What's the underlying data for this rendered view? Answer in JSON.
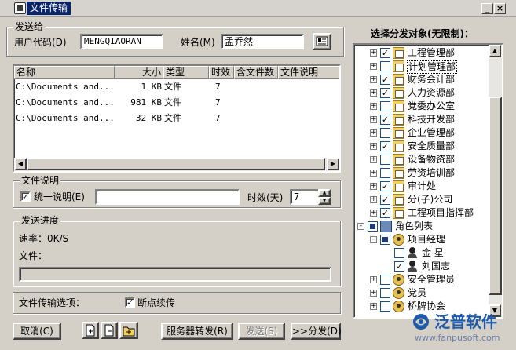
{
  "window": {
    "title": "文件传输",
    "minimize": "_",
    "close": "×"
  },
  "sender": {
    "group_label": "发送给",
    "user_code_label": "用户代码(D)",
    "user_code_value": "MENGQIAORAN",
    "name_label": "姓名(M)",
    "name_value": "孟乔然"
  },
  "file_list": {
    "columns": [
      "名称",
      "大小",
      "类型",
      "时效",
      "含文件数",
      "文件说明"
    ],
    "rows": [
      {
        "name": "C:\\Documents and...",
        "size": "1 KB",
        "type": "文件",
        "expiry": "7"
      },
      {
        "name": "C:\\Documents and...",
        "size": "981 KB",
        "type": "文件",
        "expiry": "7"
      },
      {
        "name": "C:\\Documents and...",
        "size": "32 KB",
        "type": "文件",
        "expiry": "7"
      }
    ]
  },
  "file_desc": {
    "group_label": "文件说明",
    "unified_label": "统一说明(E)",
    "unified_checked": true,
    "expiry_label": "时效(天)",
    "expiry_value": "7"
  },
  "progress": {
    "group_label": "发送进度",
    "rate_label": "速率：0K/S",
    "file_label": "文件：",
    "value": 0
  },
  "options": {
    "label": "文件传输选项：",
    "resume_label": "断点续传",
    "resume_checked": true
  },
  "buttons": {
    "cancel": "取消(C)",
    "server_forward": "服务器转发(R)",
    "send": "发送(S)",
    "distribute": ">>分发(D)"
  },
  "tree": {
    "title": "选择分发对象(无限制)：",
    "items": [
      {
        "label": "工程管理部",
        "checked": true,
        "level": 1,
        "icon": "dept-icon",
        "expander": "+"
      },
      {
        "label": "计划管理部",
        "checked": false,
        "level": 1,
        "icon": "dept-icon",
        "expander": "+",
        "selected": true
      },
      {
        "label": "财务会计部",
        "checked": true,
        "level": 1,
        "icon": "dept-icon",
        "expander": "+"
      },
      {
        "label": "人力资源部",
        "checked": true,
        "level": 1,
        "icon": "dept-icon",
        "expander": "+"
      },
      {
        "label": "党委办公室",
        "checked": false,
        "level": 1,
        "icon": "dept-icon",
        "expander": "+"
      },
      {
        "label": "科技开发部",
        "checked": true,
        "level": 1,
        "icon": "dept-icon",
        "expander": "+"
      },
      {
        "label": "企业管理部",
        "checked": false,
        "level": 1,
        "icon": "dept-icon",
        "expander": "+"
      },
      {
        "label": "安全质量部",
        "checked": true,
        "level": 1,
        "icon": "dept-icon",
        "expander": "+"
      },
      {
        "label": "设备物资部",
        "checked": false,
        "level": 1,
        "icon": "dept-icon",
        "expander": "+"
      },
      {
        "label": "劳资培训部",
        "checked": false,
        "level": 1,
        "icon": "dept-icon",
        "expander": "+"
      },
      {
        "label": "审计处",
        "checked": true,
        "level": 1,
        "icon": "dept-icon",
        "expander": "+"
      },
      {
        "label": "分(子)公司",
        "checked": true,
        "level": 1,
        "icon": "dept-icon",
        "expander": "+"
      },
      {
        "label": "工程项目指挥部",
        "checked": true,
        "level": 1,
        "icon": "dept-icon",
        "expander": "+"
      },
      {
        "label": "角色列表",
        "checked": "partial",
        "level": 0,
        "icon": "book-icon",
        "expander": "-"
      },
      {
        "label": "项目经理",
        "checked": "partial",
        "level": 1,
        "icon": "role-icon",
        "expander": "-"
      },
      {
        "label": "金 星",
        "checked": false,
        "level": 2,
        "icon": "person-icon",
        "expander": ""
      },
      {
        "label": "刘国志",
        "checked": true,
        "level": 2,
        "icon": "person-icon",
        "expander": ""
      },
      {
        "label": "安全管理员",
        "checked": false,
        "level": 1,
        "icon": "role-icon",
        "expander": "+"
      },
      {
        "label": "党员",
        "checked": false,
        "level": 1,
        "icon": "role-icon",
        "expander": "+"
      },
      {
        "label": "桥牌协会",
        "checked": false,
        "level": 1,
        "icon": "role-icon",
        "expander": "+"
      }
    ]
  },
  "watermark": {
    "name": "泛普软件",
    "url": "www.fanpusoft.com"
  },
  "colors": {
    "title_highlight": "#0a246a",
    "window_bg": "#d4d0c8",
    "watermark": "#1f5aa8"
  }
}
